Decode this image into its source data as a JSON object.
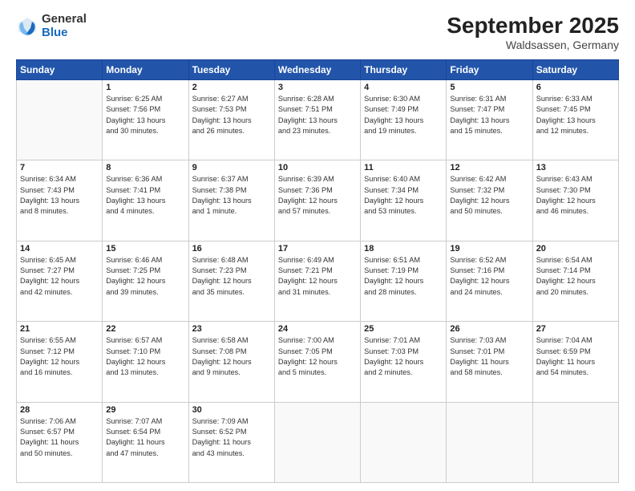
{
  "header": {
    "logo_general": "General",
    "logo_blue": "Blue",
    "month_title": "September 2025",
    "location": "Waldsassen, Germany"
  },
  "columns": [
    "Sunday",
    "Monday",
    "Tuesday",
    "Wednesday",
    "Thursday",
    "Friday",
    "Saturday"
  ],
  "weeks": [
    [
      {
        "day": "",
        "info": ""
      },
      {
        "day": "1",
        "info": "Sunrise: 6:25 AM\nSunset: 7:56 PM\nDaylight: 13 hours\nand 30 minutes."
      },
      {
        "day": "2",
        "info": "Sunrise: 6:27 AM\nSunset: 7:53 PM\nDaylight: 13 hours\nand 26 minutes."
      },
      {
        "day": "3",
        "info": "Sunrise: 6:28 AM\nSunset: 7:51 PM\nDaylight: 13 hours\nand 23 minutes."
      },
      {
        "day": "4",
        "info": "Sunrise: 6:30 AM\nSunset: 7:49 PM\nDaylight: 13 hours\nand 19 minutes."
      },
      {
        "day": "5",
        "info": "Sunrise: 6:31 AM\nSunset: 7:47 PM\nDaylight: 13 hours\nand 15 minutes."
      },
      {
        "day": "6",
        "info": "Sunrise: 6:33 AM\nSunset: 7:45 PM\nDaylight: 13 hours\nand 12 minutes."
      }
    ],
    [
      {
        "day": "7",
        "info": "Sunrise: 6:34 AM\nSunset: 7:43 PM\nDaylight: 13 hours\nand 8 minutes."
      },
      {
        "day": "8",
        "info": "Sunrise: 6:36 AM\nSunset: 7:41 PM\nDaylight: 13 hours\nand 4 minutes."
      },
      {
        "day": "9",
        "info": "Sunrise: 6:37 AM\nSunset: 7:38 PM\nDaylight: 13 hours\nand 1 minute."
      },
      {
        "day": "10",
        "info": "Sunrise: 6:39 AM\nSunset: 7:36 PM\nDaylight: 12 hours\nand 57 minutes."
      },
      {
        "day": "11",
        "info": "Sunrise: 6:40 AM\nSunset: 7:34 PM\nDaylight: 12 hours\nand 53 minutes."
      },
      {
        "day": "12",
        "info": "Sunrise: 6:42 AM\nSunset: 7:32 PM\nDaylight: 12 hours\nand 50 minutes."
      },
      {
        "day": "13",
        "info": "Sunrise: 6:43 AM\nSunset: 7:30 PM\nDaylight: 12 hours\nand 46 minutes."
      }
    ],
    [
      {
        "day": "14",
        "info": "Sunrise: 6:45 AM\nSunset: 7:27 PM\nDaylight: 12 hours\nand 42 minutes."
      },
      {
        "day": "15",
        "info": "Sunrise: 6:46 AM\nSunset: 7:25 PM\nDaylight: 12 hours\nand 39 minutes."
      },
      {
        "day": "16",
        "info": "Sunrise: 6:48 AM\nSunset: 7:23 PM\nDaylight: 12 hours\nand 35 minutes."
      },
      {
        "day": "17",
        "info": "Sunrise: 6:49 AM\nSunset: 7:21 PM\nDaylight: 12 hours\nand 31 minutes."
      },
      {
        "day": "18",
        "info": "Sunrise: 6:51 AM\nSunset: 7:19 PM\nDaylight: 12 hours\nand 28 minutes."
      },
      {
        "day": "19",
        "info": "Sunrise: 6:52 AM\nSunset: 7:16 PM\nDaylight: 12 hours\nand 24 minutes."
      },
      {
        "day": "20",
        "info": "Sunrise: 6:54 AM\nSunset: 7:14 PM\nDaylight: 12 hours\nand 20 minutes."
      }
    ],
    [
      {
        "day": "21",
        "info": "Sunrise: 6:55 AM\nSunset: 7:12 PM\nDaylight: 12 hours\nand 16 minutes."
      },
      {
        "day": "22",
        "info": "Sunrise: 6:57 AM\nSunset: 7:10 PM\nDaylight: 12 hours\nand 13 minutes."
      },
      {
        "day": "23",
        "info": "Sunrise: 6:58 AM\nSunset: 7:08 PM\nDaylight: 12 hours\nand 9 minutes."
      },
      {
        "day": "24",
        "info": "Sunrise: 7:00 AM\nSunset: 7:05 PM\nDaylight: 12 hours\nand 5 minutes."
      },
      {
        "day": "25",
        "info": "Sunrise: 7:01 AM\nSunset: 7:03 PM\nDaylight: 12 hours\nand 2 minutes."
      },
      {
        "day": "26",
        "info": "Sunrise: 7:03 AM\nSunset: 7:01 PM\nDaylight: 11 hours\nand 58 minutes."
      },
      {
        "day": "27",
        "info": "Sunrise: 7:04 AM\nSunset: 6:59 PM\nDaylight: 11 hours\nand 54 minutes."
      }
    ],
    [
      {
        "day": "28",
        "info": "Sunrise: 7:06 AM\nSunset: 6:57 PM\nDaylight: 11 hours\nand 50 minutes."
      },
      {
        "day": "29",
        "info": "Sunrise: 7:07 AM\nSunset: 6:54 PM\nDaylight: 11 hours\nand 47 minutes."
      },
      {
        "day": "30",
        "info": "Sunrise: 7:09 AM\nSunset: 6:52 PM\nDaylight: 11 hours\nand 43 minutes."
      },
      {
        "day": "",
        "info": ""
      },
      {
        "day": "",
        "info": ""
      },
      {
        "day": "",
        "info": ""
      },
      {
        "day": "",
        "info": ""
      }
    ]
  ]
}
